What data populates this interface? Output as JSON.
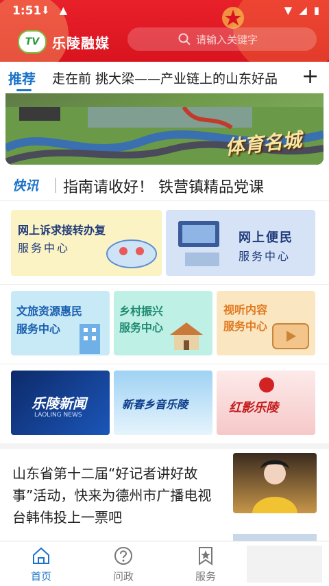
{
  "status_bar": {
    "time": "1:51"
  },
  "header": {
    "app_name": "乐陵融媒",
    "logo_text": "TV",
    "search_placeholder": "请输入关键字"
  },
  "tabs": {
    "active": "推荐",
    "headline": "走在前 挑大梁——产业链上的山东好品",
    "add_symbol": "+"
  },
  "banner": {
    "text": "体育名城"
  },
  "quick_news": {
    "label": "快讯",
    "text": "指南请收好！   铁营镇精品党课"
  },
  "services_row1": [
    {
      "line1": "网上诉求接转办复",
      "line2": "服务中心"
    },
    {
      "line1": "网上便民",
      "line2": "服务中心"
    }
  ],
  "services_row2": [
    {
      "line1": "文旅资源惠民",
      "line2": "服务中心"
    },
    {
      "line1": "乡村振兴",
      "line2": "服务中心"
    },
    {
      "line1": "视听内容",
      "line2": "服务中心"
    }
  ],
  "programs": [
    {
      "title": "乐陵新闻",
      "sub": "LAOLING NEWS"
    },
    {
      "title": "新春乡音乐陵"
    },
    {
      "title": "红影乐陵"
    }
  ],
  "article": {
    "title": "山东省第十二届“好记者讲好故事”活动，快来为德州市广播电视台韩伟投上一票吧"
  },
  "bottom_nav": [
    {
      "label": "首页",
      "icon": "home-icon"
    },
    {
      "label": "问政",
      "icon": "question-icon"
    },
    {
      "label": "服务",
      "icon": "star-bookmark-icon"
    }
  ],
  "colors": {
    "brand_red": "#e8202a",
    "accent_blue": "#1a73c8"
  }
}
